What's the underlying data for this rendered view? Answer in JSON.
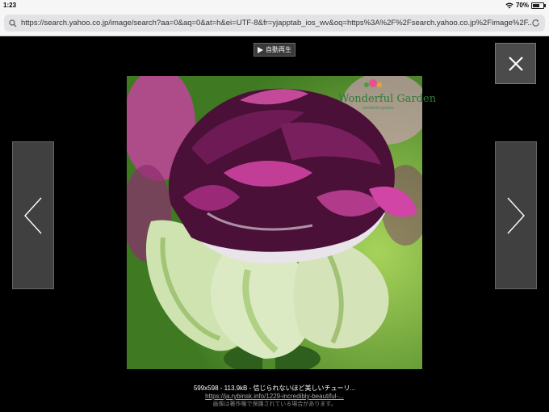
{
  "status": {
    "time": "1:23",
    "battery": "70%",
    "battery_level": 0.7
  },
  "browser": {
    "url": "https://search.yahoo.co.jp/image/search?aa=0&aq=0&at=h&ei=UTF-8&fr=yjapptab_ios_wv&oq=https%3A%2F%2Fsearch.yahoo.co.jp%2Fimage%2F..."
  },
  "viewer": {
    "autoplay_label": "自動再生",
    "image": {
      "watermark": "Wonderful Garden",
      "watermark_sub": "wonderful garden"
    },
    "meta": "599x598 - 113.9kB - 信じられないほど美しいチューリ...",
    "source_link": "https://ja.rybinsk.info/1229-incredibly-beautiful-...",
    "copyright_note": "画像は著作権で保護されている場合があります。"
  },
  "colors": {
    "background": "#000000",
    "button": "#404040"
  }
}
